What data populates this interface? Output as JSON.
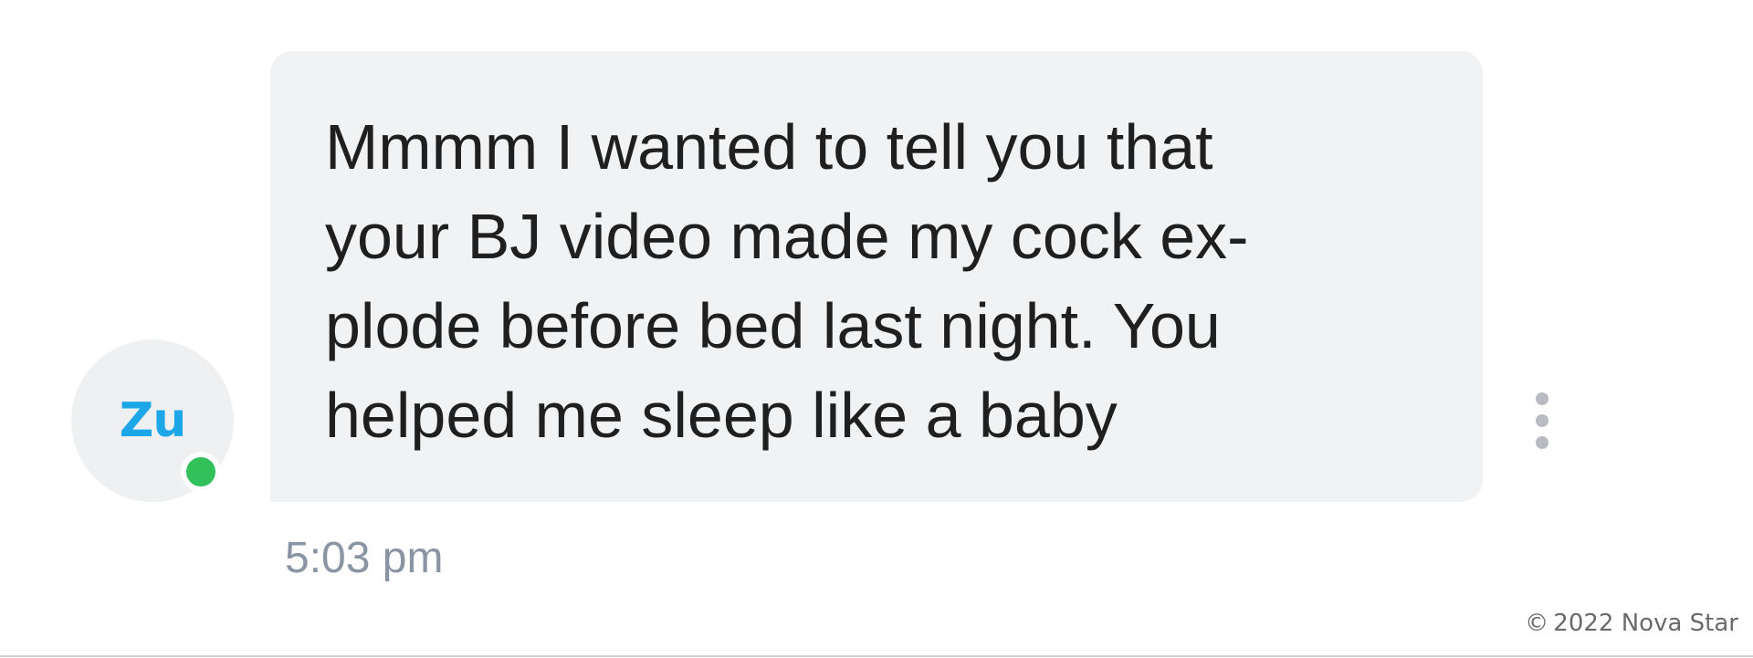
{
  "sender": {
    "initials": "Zu",
    "online": true
  },
  "message": {
    "text": "Mmmm I wanted to tell you that\nyour BJ video made my cock ex-\nplode before bed last night. You\nhelped me sleep like a baby",
    "timestamp": "5:03 pm"
  },
  "actions": {
    "more_icon": "more-vertical-icon"
  },
  "watermark": "© 2022 Nova Star",
  "colors": {
    "bubble": "#f0f2f3",
    "avatar_bg": "#eef0f2",
    "avatar_text": "#1ea7e8",
    "online": "#31c05a",
    "timestamp": "#8a95a3"
  }
}
